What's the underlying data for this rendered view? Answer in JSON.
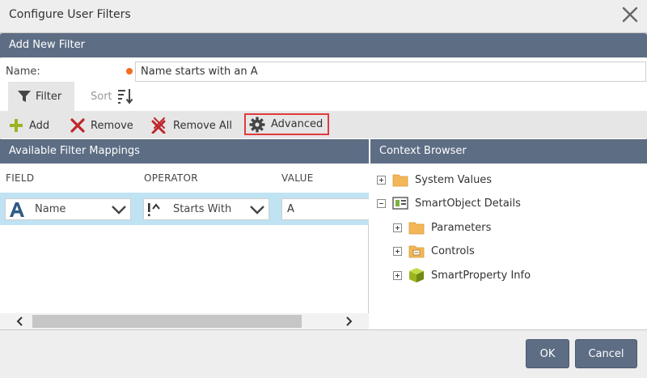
{
  "dialog": {
    "title": "Configure User Filters"
  },
  "section": {
    "title": "Add New Filter"
  },
  "name_field": {
    "label": "Name:",
    "value": "Name starts with an A"
  },
  "tabs": [
    {
      "label": "Filter",
      "icon": "funnel-icon",
      "active": true
    },
    {
      "label": "Sort",
      "icon": "sort-icon",
      "active": false
    }
  ],
  "toolbar": {
    "add": "Add",
    "remove": "Remove",
    "remove_all": "Remove All",
    "advanced": "Advanced"
  },
  "mappings": {
    "title": "Available Filter Mappings",
    "columns": [
      "FIELD",
      "OPERATOR",
      "VALUE"
    ],
    "row": {
      "field": "Name",
      "operator": "Starts With",
      "value": "A"
    }
  },
  "context_browser": {
    "title": "Context Browser",
    "items": [
      {
        "label": "System Values",
        "level": 0,
        "expanded": false,
        "icon": "folder-icon"
      },
      {
        "label": "SmartObject Details",
        "level": 0,
        "expanded": true,
        "icon": "smartobject-icon"
      },
      {
        "label": "Parameters",
        "level": 1,
        "expanded": false,
        "icon": "folder-icon"
      },
      {
        "label": "Controls",
        "level": 1,
        "expanded": false,
        "icon": "controls-folder-icon"
      },
      {
        "label": "SmartProperty Info",
        "level": 1,
        "expanded": false,
        "icon": "cube-icon"
      }
    ]
  },
  "buttons": {
    "ok": "OK",
    "cancel": "Cancel"
  },
  "colors": {
    "header": "#5d6d84",
    "selected_row": "#bfe3f3",
    "required": "#f26d21",
    "highlight": "#e03b3b",
    "add": "#9ab520",
    "remove": "#c0262d"
  }
}
